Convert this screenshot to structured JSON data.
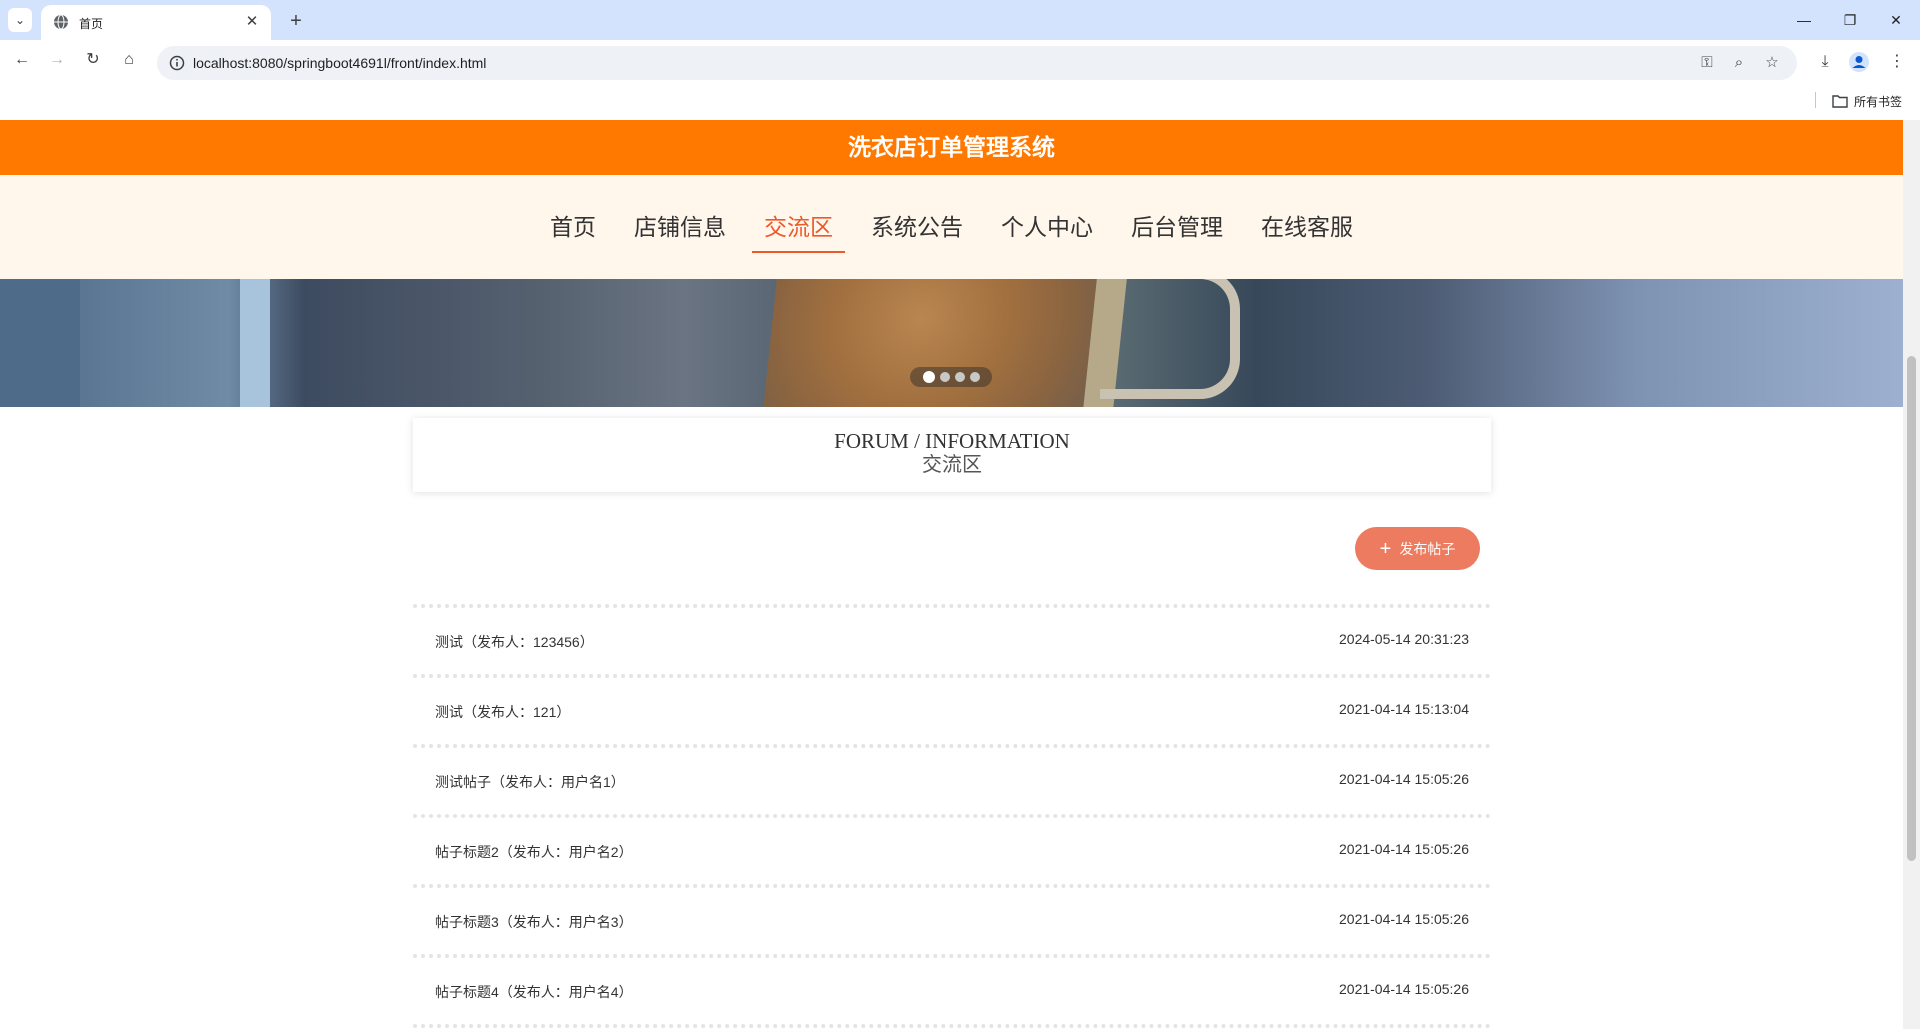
{
  "browser": {
    "tab_title": "首页",
    "url": "localhost:8080/springboot4691l/front/index.html",
    "bookmarks_label": "所有书签"
  },
  "site": {
    "title": "洗衣店订单管理系统",
    "nav": [
      {
        "label": "首页",
        "active": false
      },
      {
        "label": "店铺信息",
        "active": false
      },
      {
        "label": "交流区",
        "active": true
      },
      {
        "label": "系统公告",
        "active": false
      },
      {
        "label": "个人中心",
        "active": false
      },
      {
        "label": "后台管理",
        "active": false
      },
      {
        "label": "在线客服",
        "active": false
      }
    ]
  },
  "banner": {
    "slides": 4,
    "active_slide": 1
  },
  "section": {
    "title_en": "FORUM / INFORMATION",
    "title_cn": "交流区"
  },
  "post_button_label": "发布帖子",
  "posts": [
    {
      "title": "测试（发布人：123456）",
      "time": "2024-05-14 20:31:23"
    },
    {
      "title": "测试（发布人：121）",
      "time": "2021-04-14 15:13:04"
    },
    {
      "title": "测试帖子（发布人：用户名1）",
      "time": "2021-04-14 15:05:26"
    },
    {
      "title": "帖子标题2（发布人：用户名2）",
      "time": "2021-04-14 15:05:26"
    },
    {
      "title": "帖子标题3（发布人：用户名3）",
      "time": "2021-04-14 15:05:26"
    },
    {
      "title": "帖子标题4（发布人：用户名4）",
      "time": "2021-04-14 15:05:26"
    }
  ],
  "colors": {
    "header_bg": "#ff7800",
    "nav_bg": "#fff6ec",
    "accent": "#ec5a2a",
    "post_button_bg": "#ec7b60"
  }
}
